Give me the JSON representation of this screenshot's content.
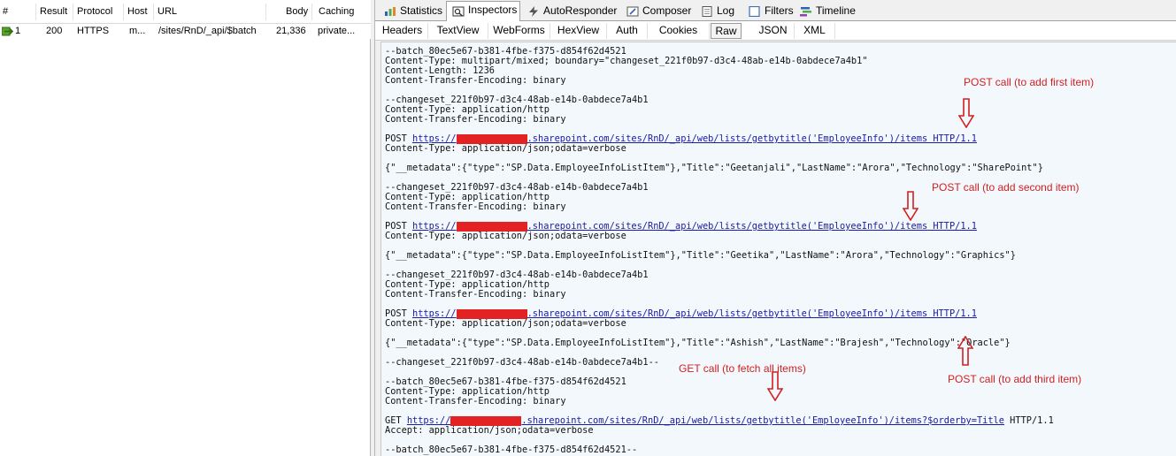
{
  "sessions": {
    "columns": [
      "#",
      "Result",
      "Protocol",
      "Host",
      "URL",
      "Body",
      "Caching"
    ],
    "rows": [
      {
        "id": "1",
        "result": "200",
        "protocol": "HTTPS",
        "host": "m...",
        "url": "/sites/RnD/_api/$batch",
        "body": "21,336",
        "caching": "private..."
      }
    ]
  },
  "main_tabs": [
    {
      "label": "Statistics",
      "icon": "statistics-icon"
    },
    {
      "label": "Inspectors",
      "icon": "inspectors-icon",
      "active": true
    },
    {
      "label": "AutoResponder",
      "icon": "lightning-icon"
    },
    {
      "label": "Composer",
      "icon": "composer-icon"
    },
    {
      "label": "Log",
      "icon": "log-icon"
    },
    {
      "label": "Filters",
      "icon": "checkbox-icon"
    },
    {
      "label": "Timeline",
      "icon": "timeline-icon"
    }
  ],
  "sub_tabs": [
    "Headers",
    "TextView",
    "WebForms",
    "HexView",
    "Auth",
    "Cookies",
    "Raw",
    "JSON",
    "XML"
  ],
  "active_sub_tab": "Raw",
  "raw_lines": [
    {
      "text": "--batch_80ec5e67-b381-4fbe-f375-d854f62d4521"
    },
    {
      "text": "Content-Type: multipart/mixed; boundary=\"changeset_221f0b97-d3c4-48ab-e14b-0abdece7a4b1\""
    },
    {
      "text": "Content-Length: 1236"
    },
    {
      "text": "Content-Transfer-Encoding: binary"
    },
    {
      "text": ""
    },
    {
      "text": "--changeset_221f0b97-d3c4-48ab-e14b-0abdece7a4b1"
    },
    {
      "text": "Content-Type: application/http"
    },
    {
      "text": "Content-Transfer-Encoding: binary"
    },
    {
      "text": ""
    },
    {
      "method": "POST ",
      "link_pre": "https://",
      "link_post": ".sharepoint.com/sites/RnD/_api/web/lists/getbytitle('EmployeeInfo')/items HTTP/1.1",
      "tail": ""
    },
    {
      "text": "Content-Type: application/json;odata=verbose"
    },
    {
      "text": ""
    },
    {
      "text": "{\"__metadata\":{\"type\":\"SP.Data.EmployeeInfoListItem\"},\"Title\":\"Geetanjali\",\"LastName\":\"Arora\",\"Technology\":\"SharePoint\"}"
    },
    {
      "text": ""
    },
    {
      "text": "--changeset_221f0b97-d3c4-48ab-e14b-0abdece7a4b1"
    },
    {
      "text": "Content-Type: application/http"
    },
    {
      "text": "Content-Transfer-Encoding: binary"
    },
    {
      "text": ""
    },
    {
      "method": "POST ",
      "link_pre": "https://",
      "link_post": ".sharepoint.com/sites/RnD/_api/web/lists/getbytitle('EmployeeInfo')/items HTTP/1.1",
      "tail": ""
    },
    {
      "text": "Content-Type: application/json;odata=verbose"
    },
    {
      "text": ""
    },
    {
      "text": "{\"__metadata\":{\"type\":\"SP.Data.EmployeeInfoListItem\"},\"Title\":\"Geetika\",\"LastName\":\"Arora\",\"Technology\":\"Graphics\"}"
    },
    {
      "text": ""
    },
    {
      "text": "--changeset_221f0b97-d3c4-48ab-e14b-0abdece7a4b1"
    },
    {
      "text": "Content-Type: application/http"
    },
    {
      "text": "Content-Transfer-Encoding: binary"
    },
    {
      "text": ""
    },
    {
      "method": "POST ",
      "link_pre": "https://",
      "link_post": ".sharepoint.com/sites/RnD/_api/web/lists/getbytitle('EmployeeInfo')/items HTTP/1.1",
      "tail": ""
    },
    {
      "text": "Content-Type: application/json;odata=verbose"
    },
    {
      "text": ""
    },
    {
      "text": "{\"__metadata\":{\"type\":\"SP.Data.EmployeeInfoListItem\"},\"Title\":\"Ashish\",\"LastName\":\"Brajesh\",\"Technology\":\"Oracle\"}"
    },
    {
      "text": ""
    },
    {
      "text": "--changeset_221f0b97-d3c4-48ab-e14b-0abdece7a4b1--"
    },
    {
      "text": ""
    },
    {
      "text": "--batch_80ec5e67-b381-4fbe-f375-d854f62d4521"
    },
    {
      "text": "Content-Type: application/http"
    },
    {
      "text": "Content-Transfer-Encoding: binary"
    },
    {
      "text": ""
    },
    {
      "method": "GET ",
      "link_pre": "https://",
      "link_post": ".sharepoint.com/sites/RnD/_api/web/lists/getbytitle('EmployeeInfo')/items?$orderby=Title",
      "tail": " HTTP/1.1"
    },
    {
      "text": "Accept: application/json;odata=verbose"
    },
    {
      "text": ""
    },
    {
      "text": "--batch_80ec5e67-b381-4fbe-f375-d854f62d4521--"
    }
  ],
  "annotations": [
    {
      "text": "POST call (to add first item)"
    },
    {
      "text": "POST call (to add second item)"
    },
    {
      "text": "POST call (to add third item)"
    },
    {
      "text": "GET call (to fetch all items)"
    }
  ],
  "colors": {
    "annotation": "#d21f1f",
    "redaction": "#e32323",
    "link": "#1a1aa6",
    "raw_background": "#f3f8fc"
  }
}
